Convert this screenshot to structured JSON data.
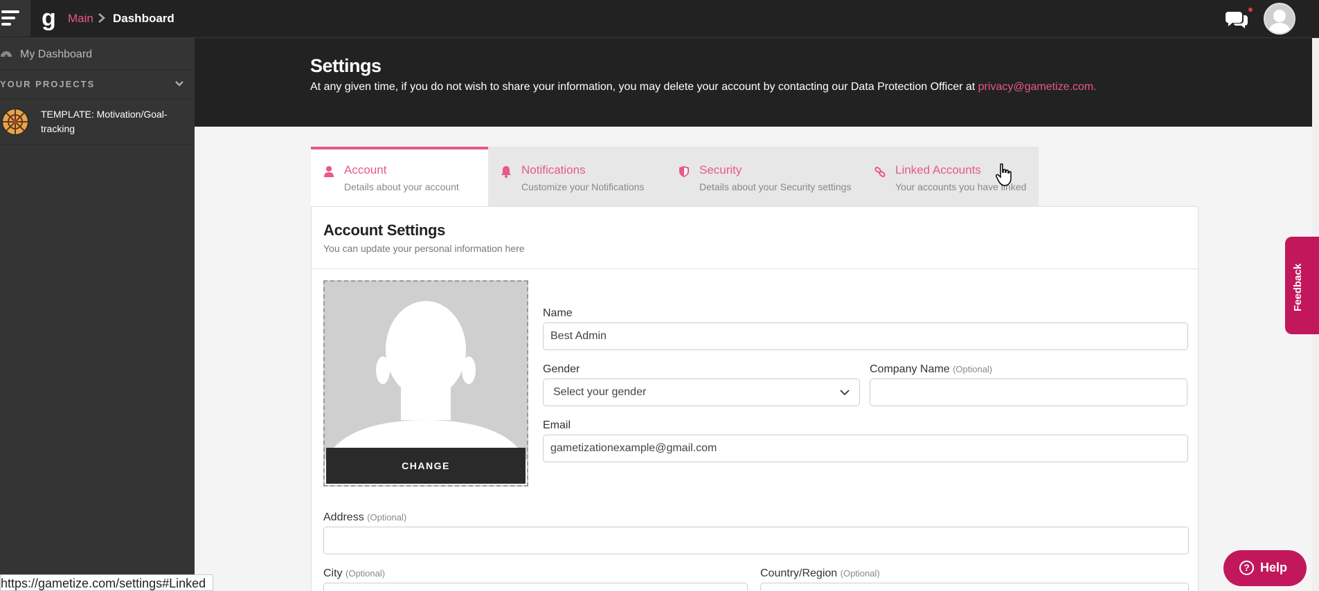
{
  "topbar": {
    "breadcrumb_main": "Main",
    "breadcrumb_current": "Dashboard",
    "icons": [
      "menu-icon",
      "gametize-logo",
      "chevron-right-icon",
      "chat-icon",
      "user-avatar"
    ]
  },
  "sidebar": {
    "dashboard_label": "My Dashboard",
    "projects_heading": "YOUR PROJECTS",
    "projects": [
      {
        "name": "TEMPLATE: Motivation/Goal-tracking"
      }
    ]
  },
  "header": {
    "title": "Settings",
    "subtitle": "At any given time, if you do not wish to share your information, you may delete your account by contacting our Data Protection Officer at",
    "email_link": "privacy@gametize.com."
  },
  "tabs": [
    {
      "title": "Account",
      "desc": "Details about your account",
      "icon": "user-icon",
      "active": true
    },
    {
      "title": "Notifications",
      "desc": "Customize your Notifications",
      "icon": "bell-icon",
      "active": false
    },
    {
      "title": "Security",
      "desc": "Details about your Security settings",
      "icon": "shield-icon",
      "active": false
    },
    {
      "title": "Linked Accounts",
      "desc": "Your accounts you have linked",
      "icon": "link-icon",
      "active": false
    }
  ],
  "account": {
    "title": "Account Settings",
    "subtitle": "You can update your personal information here",
    "change_label": "CHANGE",
    "name_label": "Name",
    "name_value": "Best Admin",
    "gender_label": "Gender",
    "gender_value": "Select your gender",
    "company_label": "Company Name",
    "optional": "(Optional)",
    "company_value": "",
    "email_label": "Email",
    "email_value": "gametizationexample@gmail.com",
    "address_label": "Address",
    "address_value": "",
    "city_label": "City",
    "country_label": "Country/Region"
  },
  "feedback_label": "Feedback",
  "help_label": "Help",
  "status_url": "https://gametize.com/settings#Linked",
  "colors": {
    "accent": "#e8588a",
    "brand": "#c2185b",
    "dark": "#222222",
    "sidebar": "#343434"
  }
}
